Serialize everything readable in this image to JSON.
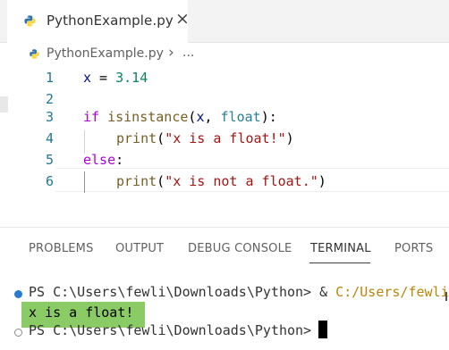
{
  "tab": {
    "filename": "PythonExample.py",
    "close_glyph": "×"
  },
  "breadcrumb": {
    "file": "PythonExample.py",
    "separator": "›",
    "more": "..."
  },
  "editor": {
    "lines": [
      {
        "num": "1"
      },
      {
        "num": "2"
      },
      {
        "num": "3"
      },
      {
        "num": "4"
      },
      {
        "num": "5"
      },
      {
        "num": "6"
      }
    ],
    "tokens": {
      "l1_x": "x",
      "l1_eq": " = ",
      "l1_val": "3.14",
      "l3_if": "if",
      "l3_sp": " ",
      "l3_fn": "isinstance",
      "l3_open": "(",
      "l3_x": "x",
      "l3_comma": ", ",
      "l3_float": "float",
      "l3_close": "):",
      "l4_print": "print",
      "l4_open": "(",
      "l4_str": "\"x is a float!\"",
      "l4_close": ")",
      "l5_else": "else",
      "l5_colon": ":",
      "l6_print": "print",
      "l6_open": "(",
      "l6_str": "\"x is not a float.\"",
      "l6_close": ")"
    }
  },
  "panel": {
    "tabs": [
      {
        "label": "PROBLEMS"
      },
      {
        "label": "OUTPUT"
      },
      {
        "label": "DEBUG CONSOLE"
      },
      {
        "label": "TERMINAL",
        "active": true
      },
      {
        "label": "PORTS"
      }
    ],
    "terminal": {
      "line1_prompt": "PS C:\\Users\\fewli\\Downloads\\Python> & ",
      "line1_path": "C:/Users/fewli/",
      "output": "x is a float!",
      "line3_prompt": "PS C:\\Users\\fewli\\Downloads\\Python> "
    }
  },
  "colors": {
    "keyword": "#af00db",
    "function": "#795e26",
    "type": "#267f99",
    "string": "#a31515",
    "number": "#098658",
    "output_highlight": "#8bcb66",
    "line_number": "#237893"
  },
  "icons": [
    "python-file-icon",
    "close-icon",
    "chevron-right-icon",
    "success-dot-icon",
    "idle-dot-icon"
  ]
}
